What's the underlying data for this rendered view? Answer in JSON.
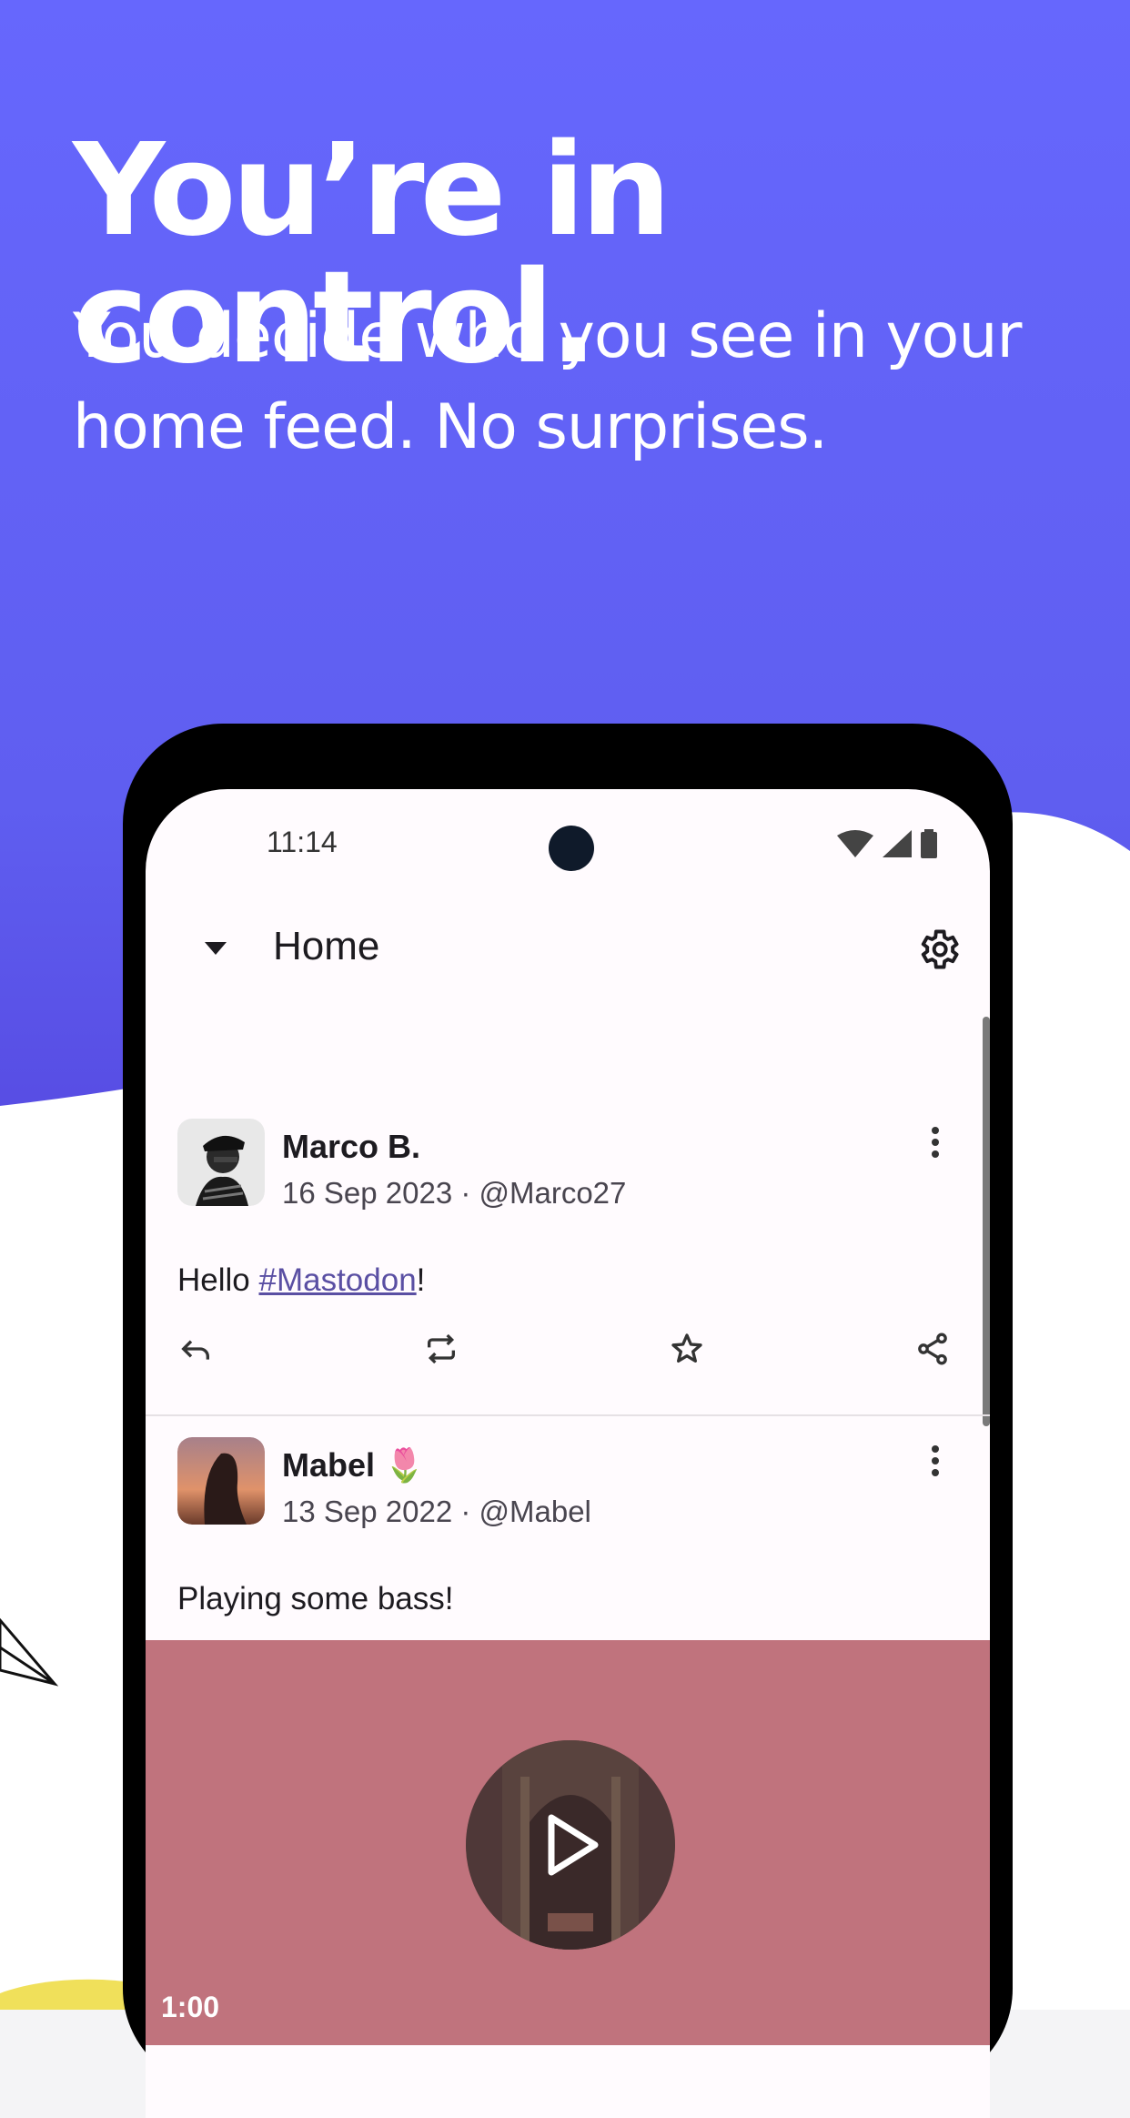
{
  "hero": {
    "headline": "You’re in control.",
    "subhead": "You decide who you see in your home feed. No surprises."
  },
  "status_bar": {
    "time": "11:14"
  },
  "app_bar": {
    "title": "Home"
  },
  "posts": [
    {
      "author": "Marco B.",
      "meta": "16 Sep 2023 · @Marco27",
      "text_prefix": "Hello ",
      "hashtag": "#Mastodon",
      "text_suffix": "!"
    },
    {
      "author": "Mabel 🌷",
      "meta": "13 Sep 2022 · @Mabel",
      "text": "Playing some bass!",
      "media_duration": "1:00"
    }
  ],
  "colors": {
    "brand": "#6364ff",
    "hashtag": "#5a4fa3",
    "media_bg": "#c0737d"
  },
  "icons": [
    "chevron-down-icon",
    "gear-icon",
    "more-vert-icon",
    "reply-icon",
    "boost-icon",
    "star-icon",
    "share-icon",
    "play-icon",
    "wifi-icon",
    "signal-icon",
    "battery-icon"
  ]
}
